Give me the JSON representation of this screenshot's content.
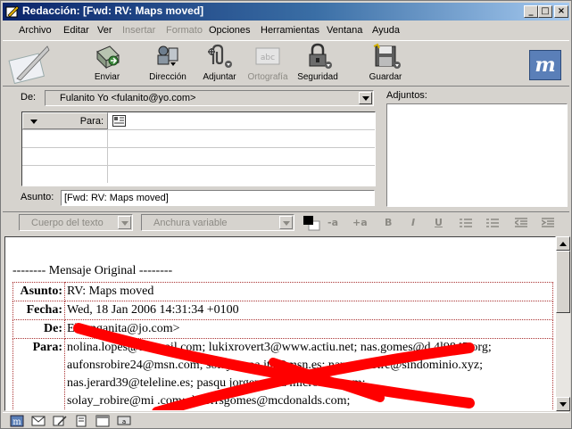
{
  "window": {
    "title": "Redacción: [Fwd: RV: Maps moved]",
    "buttons": {
      "minimize": "_",
      "maximize": "□",
      "close": "×"
    }
  },
  "menu": [
    {
      "label": "Archivo",
      "enabled": true
    },
    {
      "label": "Editar",
      "enabled": true
    },
    {
      "label": "Ver",
      "enabled": true
    },
    {
      "label": "Insertar",
      "enabled": false
    },
    {
      "label": "Formato",
      "enabled": false
    },
    {
      "label": "Opciones",
      "enabled": true
    },
    {
      "label": "Herramientas",
      "enabled": true
    },
    {
      "label": "Ventana",
      "enabled": true
    },
    {
      "label": "Ayuda",
      "enabled": true
    }
  ],
  "toolbar": {
    "send": "Enviar",
    "address": "Dirección",
    "attach": "Adjuntar",
    "spelling": "Ortografía",
    "security": "Seguridad",
    "save": "Guardar"
  },
  "compose": {
    "from_label": "De:",
    "from_value": "Fulanito Yo <fulanito@yo.com>",
    "recipient_type": "Para:",
    "subject_label": "Asunto:",
    "subject_value": "[Fwd: RV: Maps moved]",
    "attachments_label": "Adjuntos:"
  },
  "format": {
    "style": "Cuerpo del texto",
    "font": "Anchura variable",
    "smaller": "-a",
    "larger": "+a",
    "bold": "B",
    "italic": "I",
    "underline": "U"
  },
  "message": {
    "original_line": "-------- Mensaje Original --------",
    "headers": [
      {
        "key": "Asunto:",
        "value": "RV: Maps moved"
      },
      {
        "key": "Fecha:",
        "value": "Wed, 18 Jan 2006 14:31:34 +0100"
      },
      {
        "key": "De:",
        "value": "Ell        enganita@jo.com>"
      },
      {
        "key": "Para:",
        "lines": [
          "nolina.lopes@hotmail.com; lukixrovert3@www.actiu.net; nas.gomes@d       4l9845.org;",
          "aufonsrobire24@msn.com; solay-papa  ita@msn.es; naraga  obire@sindominio.xyz;",
          "nas.jerard39@teleline.es; pasqu   jorgensanta   microsoft.com;",
          "solay_robire@mi        .com; dolorrsgomes@mcdonalds.com;"
        ]
      }
    ]
  },
  "colors": {
    "title_gradient_start": "#0a246a",
    "title_gradient_end": "#a6caf0",
    "chrome": "#d6d3ce",
    "scribble": "#ff0000",
    "table_border": "#a33333"
  }
}
